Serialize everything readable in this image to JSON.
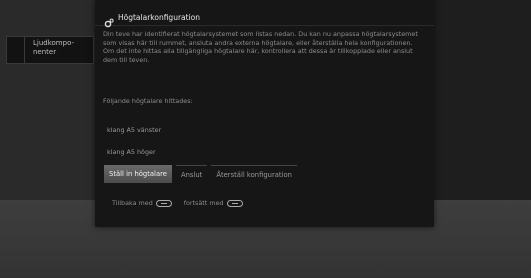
{
  "sidebar": {
    "item_label": "Ljudkompo-\nnenter"
  },
  "dialog": {
    "title": "Högtalarkonfiguration",
    "description": "Din teve har identifierat högtalarsystemet som listas nedan. Du kan nu anpassa högtalarsystemet som visas här till rummet, ansluta andra externa högtalare, eller återställa hela konfigurationen. Om det inte hittas alla tillgängliga högtalare här, kontrollera att dessa är tillkopplade eller anslut dem till teven.",
    "found_label": "Följande högtalare hittades:",
    "speakers": [
      "klang A5 vänster",
      "klang A5 höger"
    ],
    "buttons": {
      "setup": "Ställ in högtalare",
      "connect": "Anslut",
      "reset": "Återställ konfiguration"
    },
    "footer": {
      "back": "Tillbaka med",
      "continue": "fortsätt med"
    }
  },
  "icons": {
    "header": "gear-icon",
    "back_key": "remote-key-icon",
    "continue_key": "remote-key-icon"
  }
}
